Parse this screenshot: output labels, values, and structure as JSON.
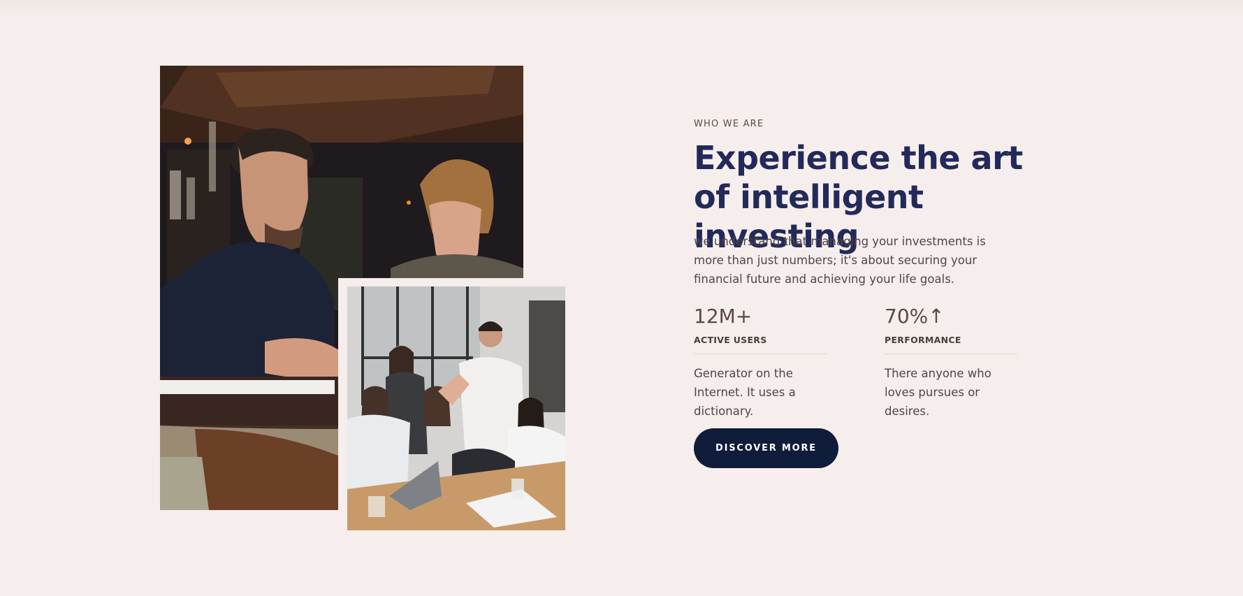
{
  "about": {
    "eyebrow": "WHO WE ARE",
    "headline": "Experience the art of intelligent investing",
    "lead": "we understand that managing your investments is more than just numbers; it's about securing your financial future and achieving your life goals.",
    "stats": [
      {
        "value": "12M+",
        "label": "ACTIVE USERS",
        "description": "Generator on the Internet. It uses a dictionary."
      },
      {
        "value": "70%↑",
        "label": "PERFORMANCE",
        "description": "There anyone who loves pursues or desires."
      }
    ],
    "cta_label": "DISCOVER MORE"
  },
  "colors": {
    "background": "#f6eeec",
    "headline": "#232a5a",
    "button": "#0f1c3a"
  }
}
